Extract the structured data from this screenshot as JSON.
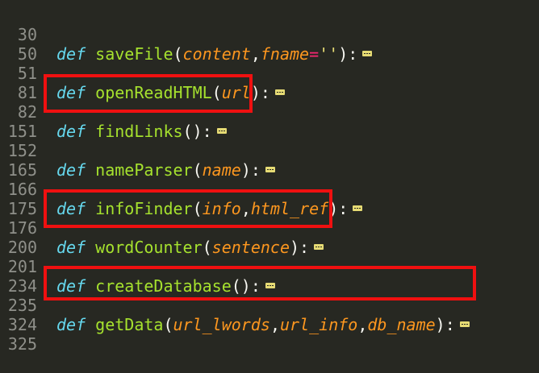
{
  "lines": [
    {
      "num": "30",
      "kw": "def",
      "fn": "saveFile",
      "open": "(",
      "p1": "content",
      "sep1": ",",
      "p2": "fname",
      "eq": "=",
      "str": "''",
      "sep2": "",
      "p3": "",
      "close": "):"
    },
    {
      "num": "50"
    },
    {
      "num": "51",
      "kw": "def",
      "fn": "openReadHTML",
      "open": "(",
      "p1": "url",
      "close": "):"
    },
    {
      "num": "81"
    },
    {
      "num": "82",
      "kw": "def",
      "fn": "findLinks",
      "open": "(",
      "close": "):"
    },
    {
      "num": "151"
    },
    {
      "num": "152",
      "kw": "def",
      "fn": "nameParser",
      "open": "(",
      "p1": "name",
      "close": "):"
    },
    {
      "num": "165"
    },
    {
      "num": "166",
      "kw": "def",
      "fn": "infoFinder",
      "open": "(",
      "p1": "info",
      "sep1": ",",
      "p2": "html_ref",
      "close": "):"
    },
    {
      "num": "175"
    },
    {
      "num": "176",
      "kw": "def",
      "fn": "wordCounter",
      "open": "(",
      "p1": "sentence",
      "close": "):"
    },
    {
      "num": "200"
    },
    {
      "num": "201",
      "kw": "def",
      "fn": "createDatabase",
      "open": "(",
      "close": "):"
    },
    {
      "num": "234"
    },
    {
      "num": "235",
      "kw": "def",
      "fn": "getData",
      "open": "(",
      "p1": "url_lwords",
      "sep1": ",",
      "p2": "url_info",
      "sep2": ",",
      "p3": "db_name",
      "close": "):"
    },
    {
      "num": "324"
    },
    {
      "num": "325"
    }
  ],
  "highlight_color": "#f01010",
  "fold_icon": "fold-ellipsis-icon"
}
